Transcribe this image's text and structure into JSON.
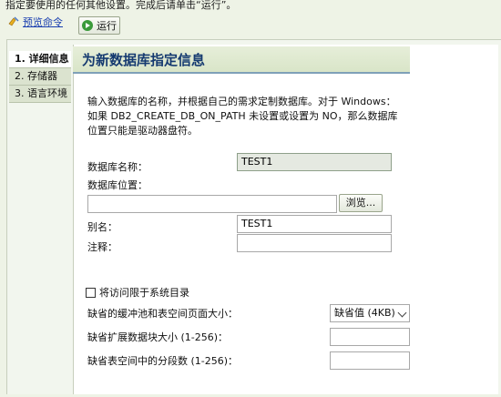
{
  "top_note": "指定要使用的任何其他设置。完成后请单击“运行”。",
  "toolbar": {
    "preview_label": "预览命令",
    "run_label": "运行"
  },
  "nav": {
    "items": [
      {
        "label": "1. 详细信息"
      },
      {
        "label": "2. 存储器"
      },
      {
        "label": "3. 语言环境"
      }
    ]
  },
  "page": {
    "title": "为新数据库指定信息",
    "description": "输入数据库的名称，并根据自己的需求定制数据库。对于 Windows：如果 DB2_CREATE_DB_ON_PATH 未设置或设置为 NO，那么数据库位置只能是驱动器盘符。"
  },
  "form": {
    "db_name_label": "数据库名称：",
    "db_name_value": "TEST1",
    "db_location_label": "数据库位置：",
    "db_location_value": "",
    "browse_label": "浏览...",
    "alias_label": "别名：",
    "alias_value": "TEST1",
    "comment_label": "注释：",
    "comment_value": "",
    "restrict_label": "将访问限于系统目录",
    "restrict_checked": false,
    "pagesize_label": "缺省的缓冲池和表空间页面大小：",
    "pagesize_value": "缺省值 (4KB)",
    "extent_label": "缺省扩展数据块大小 (1-256)：",
    "extent_value": "",
    "segments_label": "缺省表空间中的分段数 (1-256)：",
    "segments_value": ""
  }
}
